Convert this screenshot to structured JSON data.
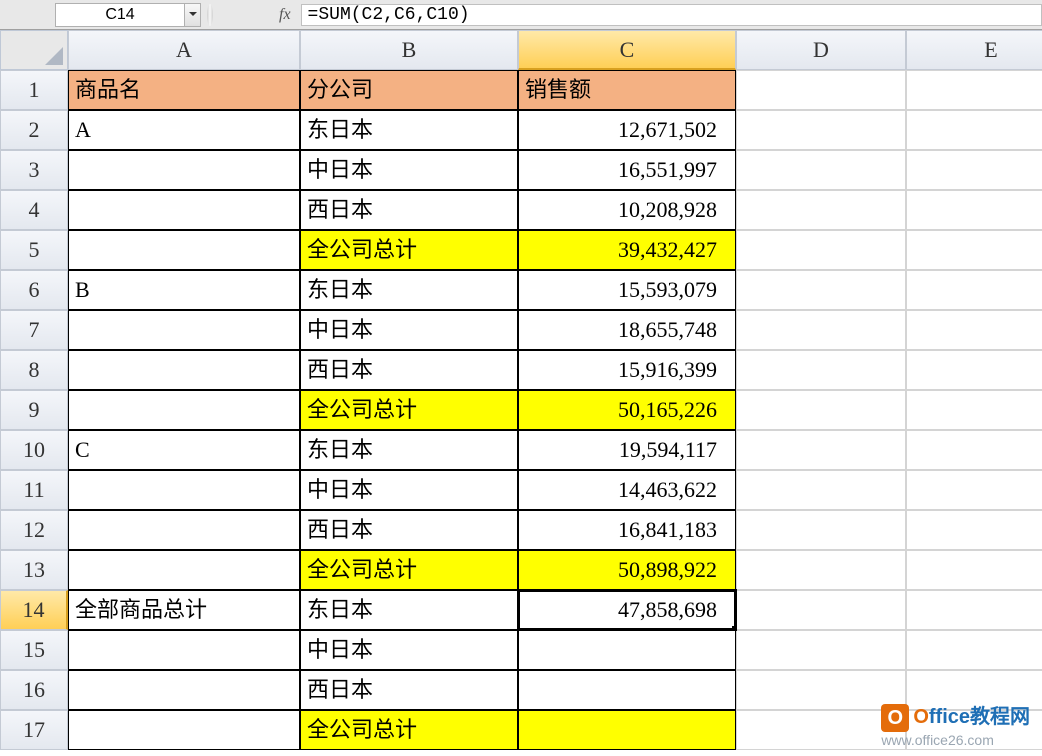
{
  "formula_bar": {
    "cell_ref": "C14",
    "fx_label": "fx",
    "formula": "=SUM(C2,C6,C10)"
  },
  "columns": [
    "A",
    "B",
    "C",
    "D",
    "E"
  ],
  "rows": [
    "1",
    "2",
    "3",
    "4",
    "5",
    "6",
    "7",
    "8",
    "9",
    "10",
    "11",
    "12",
    "13",
    "14",
    "15",
    "16",
    "17"
  ],
  "headers": {
    "A": "商品名",
    "B": "分公司",
    "C": "销售额"
  },
  "cells": {
    "A2": "A",
    "B2": "东日本",
    "C2": "12,671,502",
    "B3": "中日本",
    "C3": "16,551,997",
    "B4": "西日本",
    "C4": "10,208,928",
    "B5": "全公司总计",
    "C5": "39,432,427",
    "A6": "B",
    "B6": "东日本",
    "C6": "15,593,079",
    "B7": "中日本",
    "C7": "18,655,748",
    "B8": "西日本",
    "C8": "15,916,399",
    "B9": "全公司总计",
    "C9": "50,165,226",
    "A10": "C",
    "B10": "东日本",
    "C10": "19,594,117",
    "B11": "中日本",
    "C11": "14,463,622",
    "B12": "西日本",
    "C12": "16,841,183",
    "B13": "全公司总计",
    "C13": "50,898,922",
    "A14": "全部商品总计",
    "B14": "东日本",
    "C14": "47,858,698",
    "B15": "中日本",
    "B16": "西日本",
    "B17": "全公司总计"
  },
  "watermark": {
    "logo_letter": "O",
    "brand_o": "O",
    "brand_rest": "ffice教程网",
    "url": "www.office26.com"
  }
}
